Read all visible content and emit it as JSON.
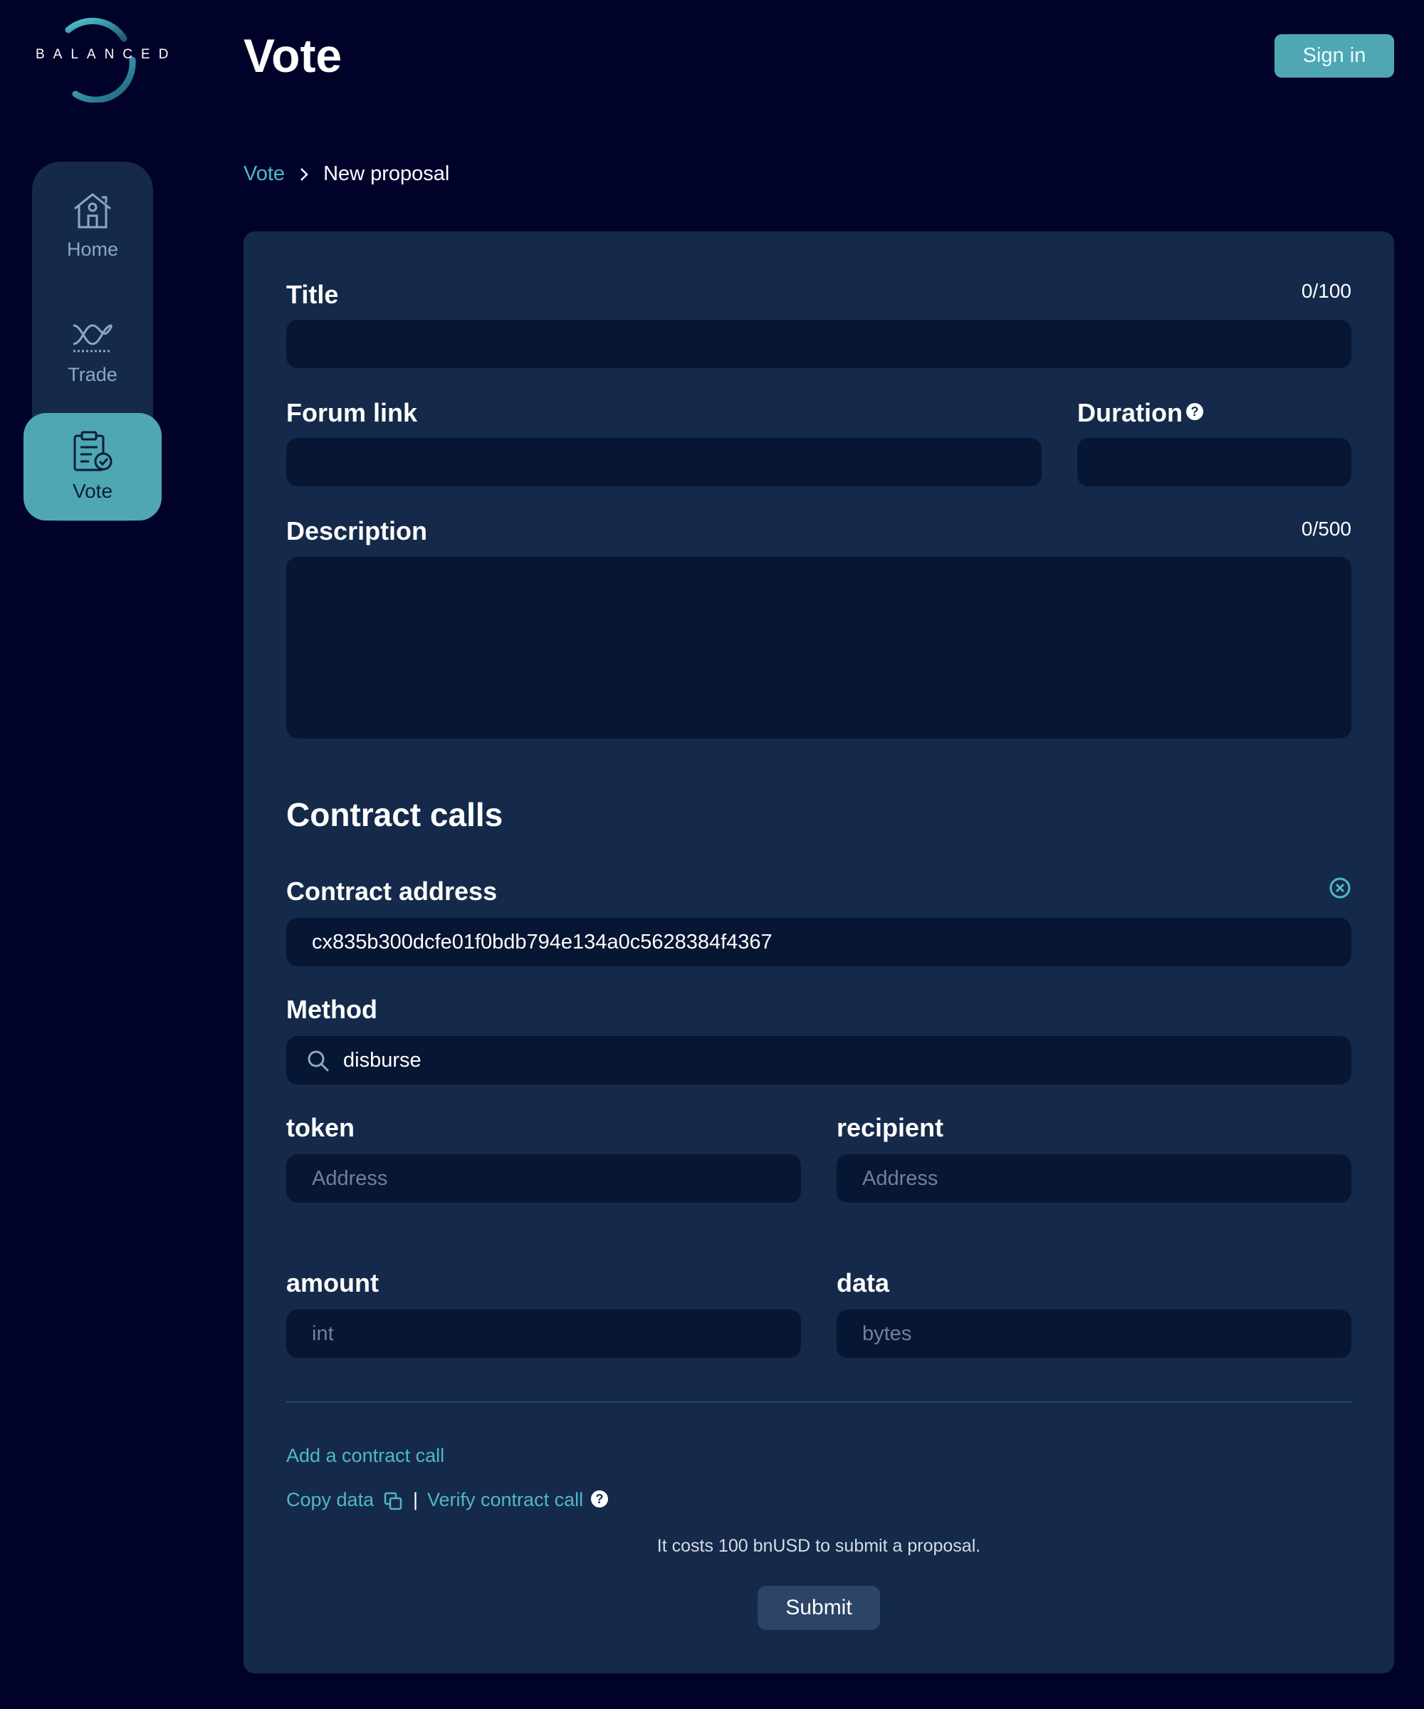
{
  "brand": {
    "logo_text": "BALANCED"
  },
  "header": {
    "title": "Vote",
    "signin_label": "Sign in"
  },
  "nav": {
    "items": [
      {
        "label": "Home",
        "icon": "home-icon"
      },
      {
        "label": "Trade",
        "icon": "trade-icon"
      },
      {
        "label": "Vote",
        "icon": "vote-icon",
        "active": true
      }
    ]
  },
  "breadcrumb": {
    "parent": "Vote",
    "current": "New proposal"
  },
  "form": {
    "title": {
      "label": "Title",
      "counter": "0/100",
      "value": ""
    },
    "forum_link": {
      "label": "Forum link",
      "value": ""
    },
    "duration": {
      "label": "Duration",
      "value": ""
    },
    "description": {
      "label": "Description",
      "counter": "0/500",
      "value": ""
    }
  },
  "contract_calls": {
    "section_title": "Contract calls",
    "address": {
      "label": "Contract address",
      "value": "cx835b300dcfe01f0bdb794e134a0c5628384f4367"
    },
    "method": {
      "label": "Method",
      "value": "disburse"
    },
    "params": {
      "token": {
        "label": "token",
        "placeholder": "Address"
      },
      "recipient": {
        "label": "recipient",
        "placeholder": "Address"
      },
      "amount": {
        "label": "amount",
        "placeholder": "int"
      },
      "data": {
        "label": "data",
        "placeholder": "bytes"
      }
    }
  },
  "actions": {
    "add_call": "Add a contract call",
    "copy_data": "Copy data",
    "separator": "|",
    "verify_call": "Verify contract call",
    "help_glyph": "?",
    "cost_note": "It costs 100 bnUSD to submit a proposal.",
    "submit_label": "Submit"
  },
  "colors": {
    "background": "#01022a",
    "card": "#152a4a",
    "field": "#071632",
    "accent": "#4fa7b3"
  }
}
